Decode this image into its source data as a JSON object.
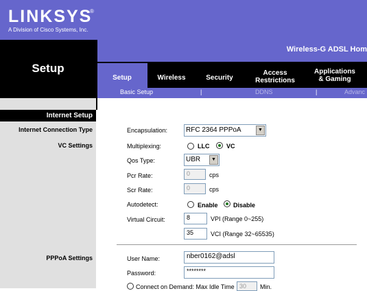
{
  "brand": {
    "logo": "LINKSYS",
    "trademark": "®",
    "subtitle": "A Division of Cisco Systems, Inc."
  },
  "model": "Wireless-G ADSL Hom",
  "page_title": "Setup",
  "tabs": [
    {
      "label": "Setup"
    },
    {
      "label": "Wireless"
    },
    {
      "label": "Security"
    },
    {
      "label": "Access\nRestrictions"
    },
    {
      "label": "Applications\n& Gaming"
    }
  ],
  "subtabs": [
    {
      "label": "Basic Setup"
    },
    {
      "label": "|"
    },
    {
      "label": "DDNS"
    },
    {
      "label": "|"
    },
    {
      "label": "Advanc"
    }
  ],
  "left": {
    "section_header": "Internet Setup",
    "connection_type": "Internet Connection Type",
    "vc_settings": "VC Settings",
    "pppoa_settings": "PPPoA Settings"
  },
  "form": {
    "encapsulation_label": "Encapsulation:",
    "encapsulation_value": "RFC 2364 PPPoA",
    "multiplexing_label": "Multiplexing:",
    "multiplexing_options": [
      "LLC",
      "VC"
    ],
    "multiplexing_selected": "VC",
    "qos_label": "Qos Type:",
    "qos_value": "UBR",
    "pcr_label": "Pcr Rate:",
    "pcr_value": "0",
    "pcr_unit": "cps",
    "scr_label": "Scr Rate:",
    "scr_value": "0",
    "scr_unit": "cps",
    "autodetect_label": "Autodetect:",
    "autodetect_options": [
      "Enable",
      "Disable"
    ],
    "autodetect_selected": "Disable",
    "vc_label": "Virtual Circuit:",
    "vpi_value": "8",
    "vpi_hint": "VPI (Range 0~255)",
    "vci_value": "35",
    "vci_hint": "VCI (Range 32~65535)",
    "username_label": "User Name:",
    "username_value": "nber0162@adsl",
    "password_label": "Password:",
    "password_value": "********",
    "connect_on_demand": "Connect on Demand: Max Idle Time",
    "idle_value": "30",
    "idle_unit": "Min."
  }
}
